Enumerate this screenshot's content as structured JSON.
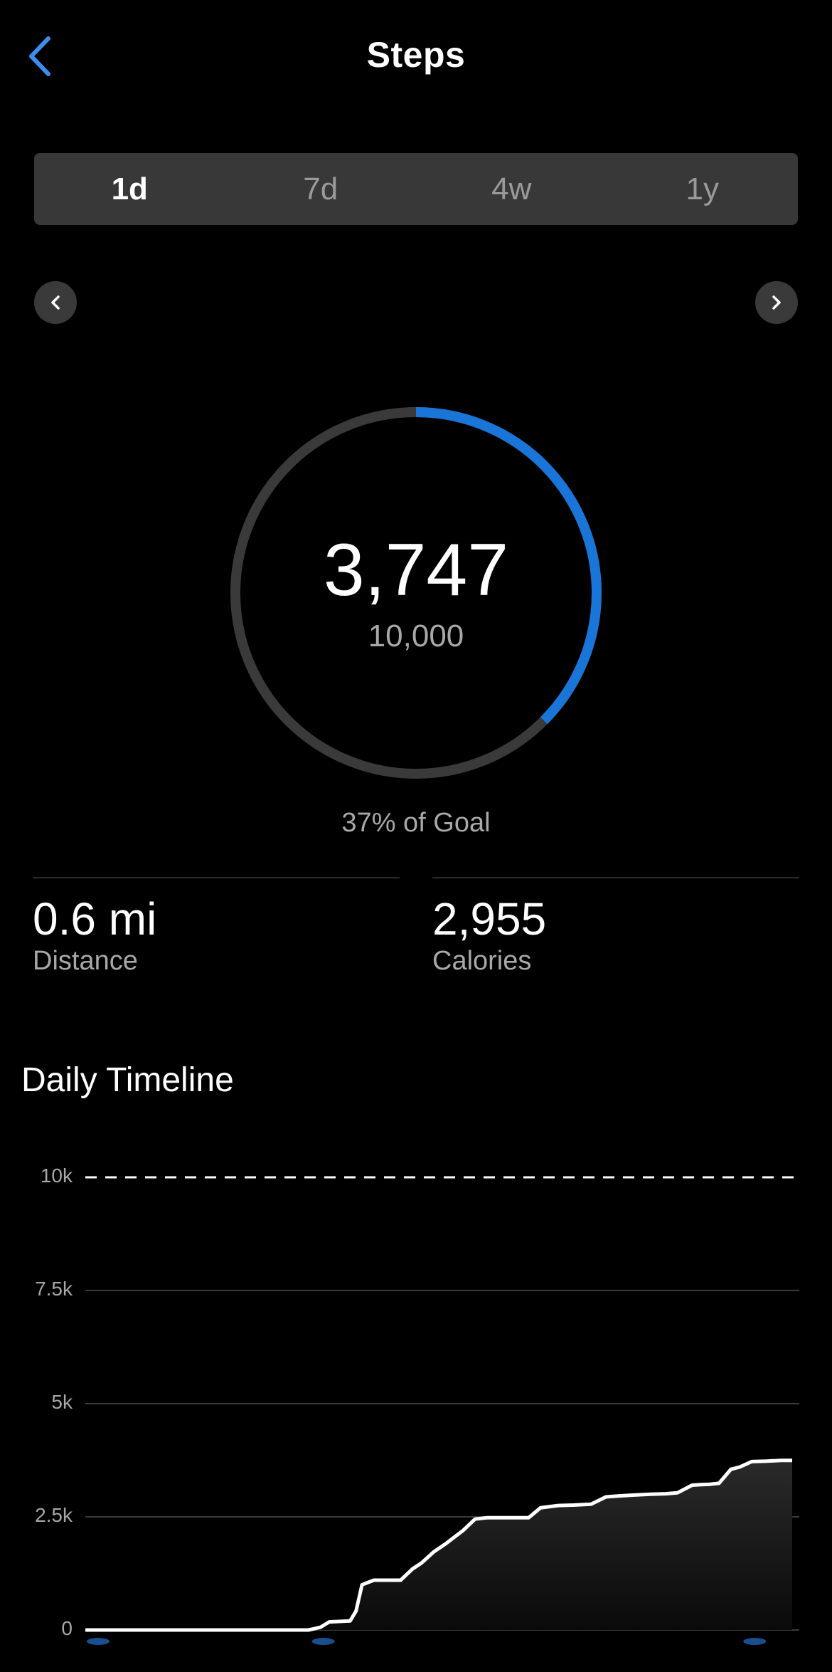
{
  "header": {
    "title": "Steps"
  },
  "tabs": [
    {
      "label": "1d",
      "active": true
    },
    {
      "label": "7d",
      "active": false
    },
    {
      "label": "4w",
      "active": false
    },
    {
      "label": "1y",
      "active": false
    }
  ],
  "summary": {
    "steps": "3,747",
    "goal": "10,000",
    "progress_fraction": 0.3747,
    "goal_text": "37% of Goal"
  },
  "stats": {
    "distance": {
      "value": "0.6 mi",
      "label": "Distance"
    },
    "calories": {
      "value": "2,955",
      "label": "Calories"
    }
  },
  "timeline": {
    "title": "Daily Timeline"
  },
  "colors": {
    "accent": "#1a75d9",
    "ring_track": "#3a3a3a",
    "background": "#000000"
  },
  "icons": {
    "back": "chevron-left-icon",
    "prev": "chevron-left-icon",
    "next": "chevron-right-icon"
  },
  "chart_data": {
    "type": "area",
    "xlabel": "",
    "ylabel": "",
    "ylim": [
      0,
      10000
    ],
    "yticks": [
      0,
      2500,
      5000,
      7500,
      10000
    ],
    "ytick_labels": [
      "0",
      "2.5k",
      "5k",
      "7.5k",
      "10k"
    ],
    "goal_line": 10000,
    "grid": true,
    "x_range_hours": [
      0,
      24
    ],
    "series": [
      {
        "x": [
          0,
          7.5,
          7.9,
          8.2,
          8.9,
          9.1,
          9.3,
          9.7,
          10.0,
          10.3,
          10.6,
          11.0,
          11.3,
          11.7,
          12.1,
          12.7,
          13.1,
          13.5,
          14.2,
          14.6,
          14.9,
          15.3,
          15.9,
          16.4,
          17.0,
          17.5,
          17.9,
          18.4,
          19.0,
          19.5,
          19.9,
          20.4,
          20.7,
          21.0,
          21.3,
          21.7,
          22.0,
          22.4,
          22.9,
          23.4,
          24.0
        ],
        "y": [
          0,
          0,
          60,
          180,
          200,
          420,
          1000,
          1100,
          1100,
          1100,
          1100,
          1350,
          1480,
          1720,
          1900,
          2200,
          2450,
          2480,
          2480,
          2480,
          2480,
          2700,
          2750,
          2760,
          2780,
          2940,
          2960,
          2980,
          3000,
          3010,
          3030,
          3200,
          3210,
          3220,
          3240,
          3550,
          3600,
          3720,
          3730,
          3747,
          3747
        ]
      }
    ]
  }
}
